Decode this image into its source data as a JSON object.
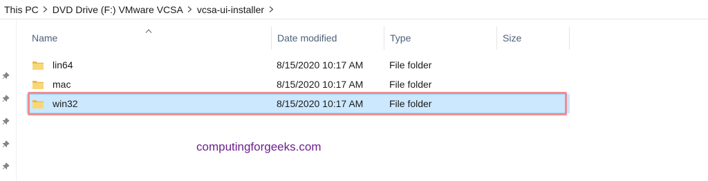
{
  "breadcrumb": {
    "items": [
      "This PC",
      "DVD Drive (F:) VMware VCSA",
      "vcsa-ui-installer"
    ]
  },
  "columns": {
    "name": "Name",
    "date_modified": "Date modified",
    "type": "Type",
    "size": "Size",
    "sort_column": "name",
    "sort_direction": "ascending"
  },
  "files": [
    {
      "name": "lin64",
      "date_modified": "8/15/2020 10:17 AM",
      "type": "File folder",
      "size": "",
      "icon": "folder-icon",
      "selected": false
    },
    {
      "name": "mac",
      "date_modified": "8/15/2020 10:17 AM",
      "type": "File folder",
      "size": "",
      "icon": "folder-icon",
      "selected": false
    },
    {
      "name": "win32",
      "date_modified": "8/15/2020 10:17 AM",
      "type": "File folder",
      "size": "",
      "icon": "folder-icon",
      "selected": true
    }
  ],
  "quick_access_pins": [
    "pin-icon",
    "pin-icon",
    "pin-icon",
    "pin-icon",
    "pin-icon"
  ],
  "watermark": "computingforgeeks.com",
  "colors": {
    "selection_fill": "#cce8ff",
    "highlight_outline": "#f08c8c",
    "folder_yellow": "#f8d775",
    "watermark": "#6b1f8f"
  }
}
